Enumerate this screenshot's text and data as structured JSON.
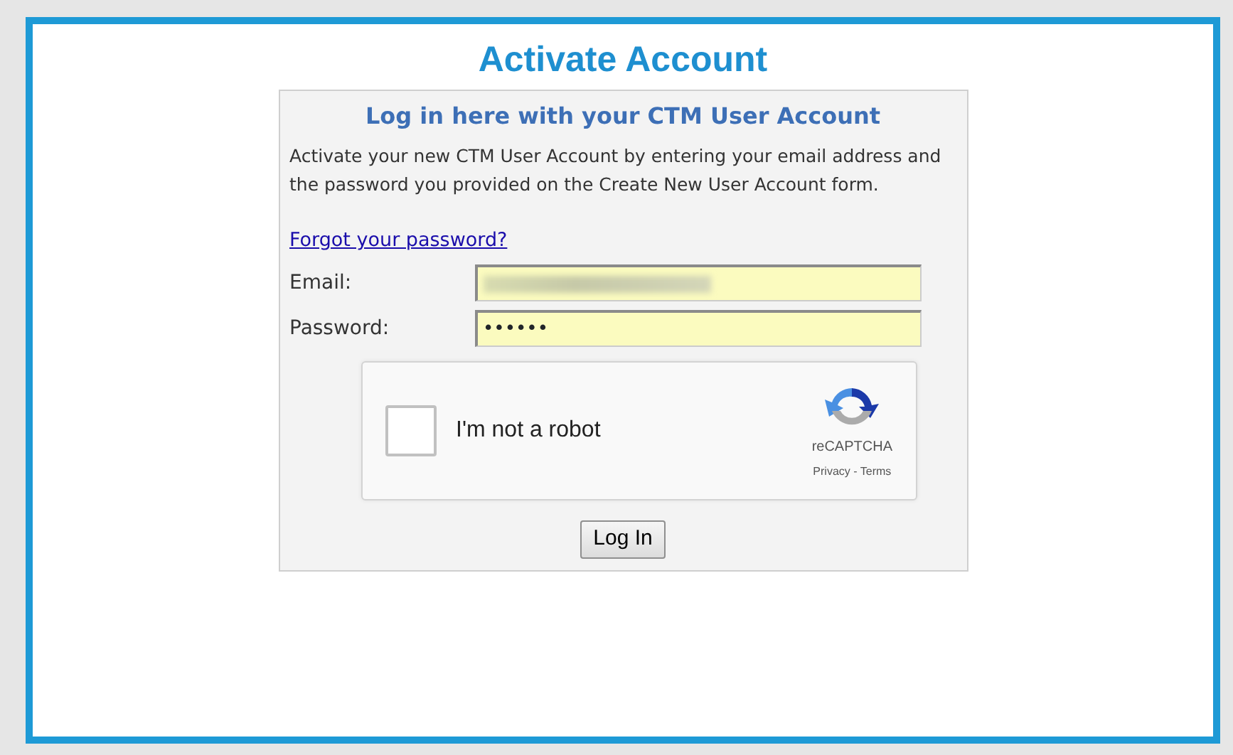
{
  "page_title": "Activate Account",
  "panel": {
    "heading": "Log in here with your CTM User Account",
    "intro": "Activate your new CTM User Account by entering your email address and the password you provided on the Create New User Account form.",
    "forgot_link": "Forgot your password?",
    "fields": [
      {
        "label": "Email:",
        "redacted": true
      },
      {
        "label": "Password:",
        "value": "••••••",
        "redacted": false
      }
    ],
    "captcha": {
      "label": "I'm not a robot",
      "checked": false,
      "brand": "reCAPTCHA",
      "links": "Privacy - Terms"
    },
    "submit": "Log In"
  }
}
